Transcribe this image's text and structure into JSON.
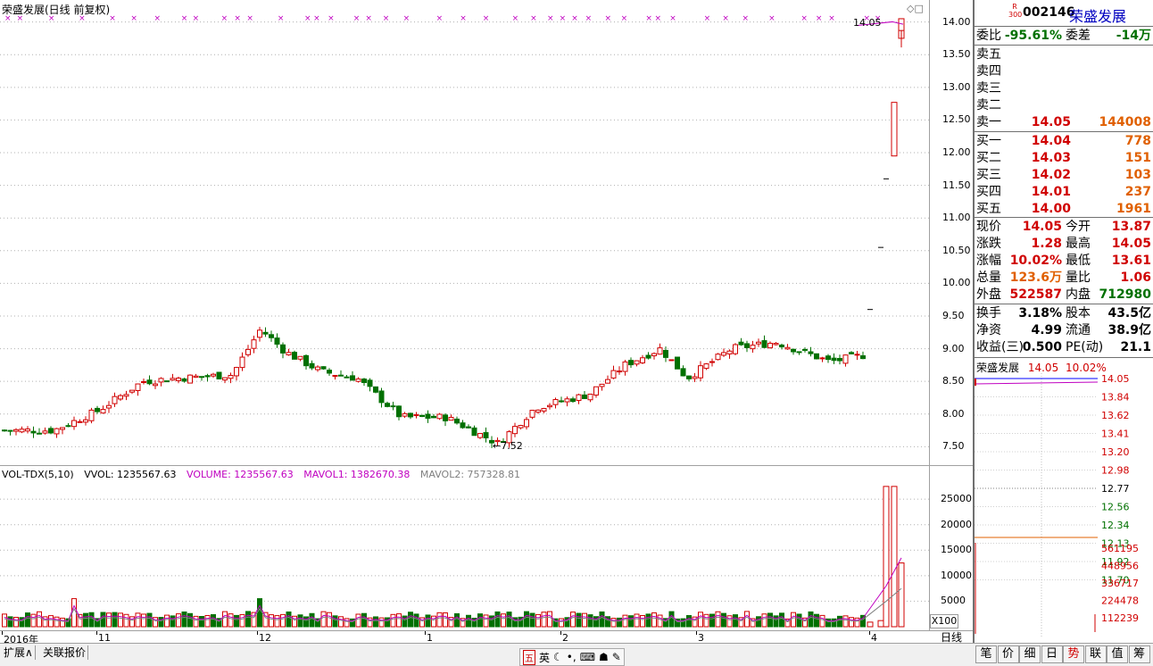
{
  "kline": {
    "title": "荣盛发展(日线 前复权)",
    "low_marker": "←7.52",
    "high_marker": "14.05",
    "y_ticks": [
      "14.00",
      "13.50",
      "13.00",
      "12.50",
      "12.00",
      "11.50",
      "11.00",
      "10.50",
      "10.00",
      "9.50",
      "9.00",
      "8.50",
      "8.00",
      "7.50"
    ]
  },
  "volume": {
    "indicator": "VOL-TDX(5,10)",
    "vvol": "VVOL: 1235567.63",
    "volume": "VOLUME: 1235567.63",
    "mavol1": "MAVOL1: 1382670.38",
    "mavol2": "MAVOL2: 757328.81",
    "y_ticks": [
      "25000",
      "20000",
      "15000",
      "10000",
      "5000"
    ],
    "unit": "X100"
  },
  "x_axis": {
    "labels": [
      "2016年",
      "11",
      "12",
      "1",
      "2",
      "3",
      "4"
    ],
    "period": "日线"
  },
  "stock": {
    "badge_top": "R",
    "badge_bottom": "300",
    "code": "002146",
    "name": "荣盛发展"
  },
  "order_book": {
    "weibi_label": "委比",
    "weibi": "-95.61%",
    "weicha_label": "委差",
    "weicha": "-14万",
    "sells": [
      {
        "label": "卖五",
        "price": "",
        "vol": ""
      },
      {
        "label": "卖四",
        "price": "",
        "vol": ""
      },
      {
        "label": "卖三",
        "price": "",
        "vol": ""
      },
      {
        "label": "卖二",
        "price": "",
        "vol": ""
      },
      {
        "label": "卖一",
        "price": "14.05",
        "vol": "144008"
      }
    ],
    "buys": [
      {
        "label": "买一",
        "price": "14.04",
        "vol": "778"
      },
      {
        "label": "买二",
        "price": "14.03",
        "vol": "151"
      },
      {
        "label": "买三",
        "price": "14.02",
        "vol": "103"
      },
      {
        "label": "买四",
        "price": "14.01",
        "vol": "237"
      },
      {
        "label": "买五",
        "price": "14.00",
        "vol": "1961"
      }
    ]
  },
  "quote": {
    "rows": [
      {
        "l1": "现价",
        "v1": "14.05",
        "l2": "今开",
        "v2": "13.87"
      },
      {
        "l1": "涨跌",
        "v1": "1.28",
        "l2": "最高",
        "v2": "14.05"
      },
      {
        "l1": "涨幅",
        "v1": "10.02%",
        "l2": "最低",
        "v2": "13.61"
      },
      {
        "l1": "总量",
        "v1": "123.6万",
        "l2": "量比",
        "v2": "1.06"
      },
      {
        "l1": "外盘",
        "v1": "522587",
        "l2": "内盘",
        "v2": "712980"
      }
    ],
    "rows2": [
      {
        "l1": "换手",
        "v1": "3.18%",
        "l2": "股本",
        "v2": "43.5亿"
      },
      {
        "l1": "净资",
        "v1": "4.99",
        "l2": "流通",
        "v2": "38.9亿"
      },
      {
        "l1": "收益(三)",
        "v1": "0.500",
        "l2": "PE(动)",
        "v2": "21.1"
      }
    ]
  },
  "intraday": {
    "name": "荣盛发展",
    "price": "14.05",
    "pct": "10.02%",
    "price_ticks": [
      "14.05",
      "13.84",
      "13.62",
      "13.41",
      "13.20",
      "12.98",
      "12.77",
      "12.56",
      "12.34",
      "12.13",
      "11.92",
      "11.70"
    ],
    "vol_ticks": [
      "561195",
      "448956",
      "336717",
      "224478",
      "112239"
    ]
  },
  "tabs": {
    "left": [
      "扩展∧",
      "关联报价"
    ],
    "right": [
      "笔",
      "价",
      "细",
      "日",
      "势",
      "联",
      "值",
      "筹"
    ],
    "active_right": "势"
  },
  "ime": {
    "a": "五",
    "b": "英"
  },
  "colors": {
    "up": "#d00000",
    "down": "#007000",
    "ma1": "#c000c0",
    "grid": "#b0b0b0"
  }
}
